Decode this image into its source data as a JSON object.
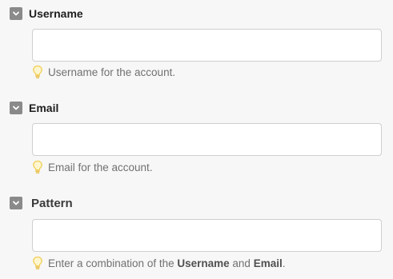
{
  "fields": [
    {
      "label": "Username",
      "toggle_icon": "chevron-down-icon",
      "value": "",
      "hint_icon": "lightbulb-icon",
      "hint": "Username for the account."
    },
    {
      "label": "Email",
      "toggle_icon": "chevron-down-icon",
      "value": "",
      "hint_icon": "lightbulb-icon",
      "hint": "Email for the account."
    },
    {
      "label": "Pattern",
      "toggle_icon": "chevron-down-icon",
      "value": "",
      "hint_icon": "lightbulb-icon",
      "hint_parts": {
        "prefix": "Enter a combination of the ",
        "first_ref": "Username",
        "middle": " and ",
        "second_ref": "Email",
        "suffix": "."
      }
    }
  ],
  "colors": {
    "background": "#f7f7f7",
    "toggle": "#8a8a8a",
    "input_border": "#cfcfcf",
    "hint_text": "#717171",
    "bulb": "#f2cf55"
  }
}
